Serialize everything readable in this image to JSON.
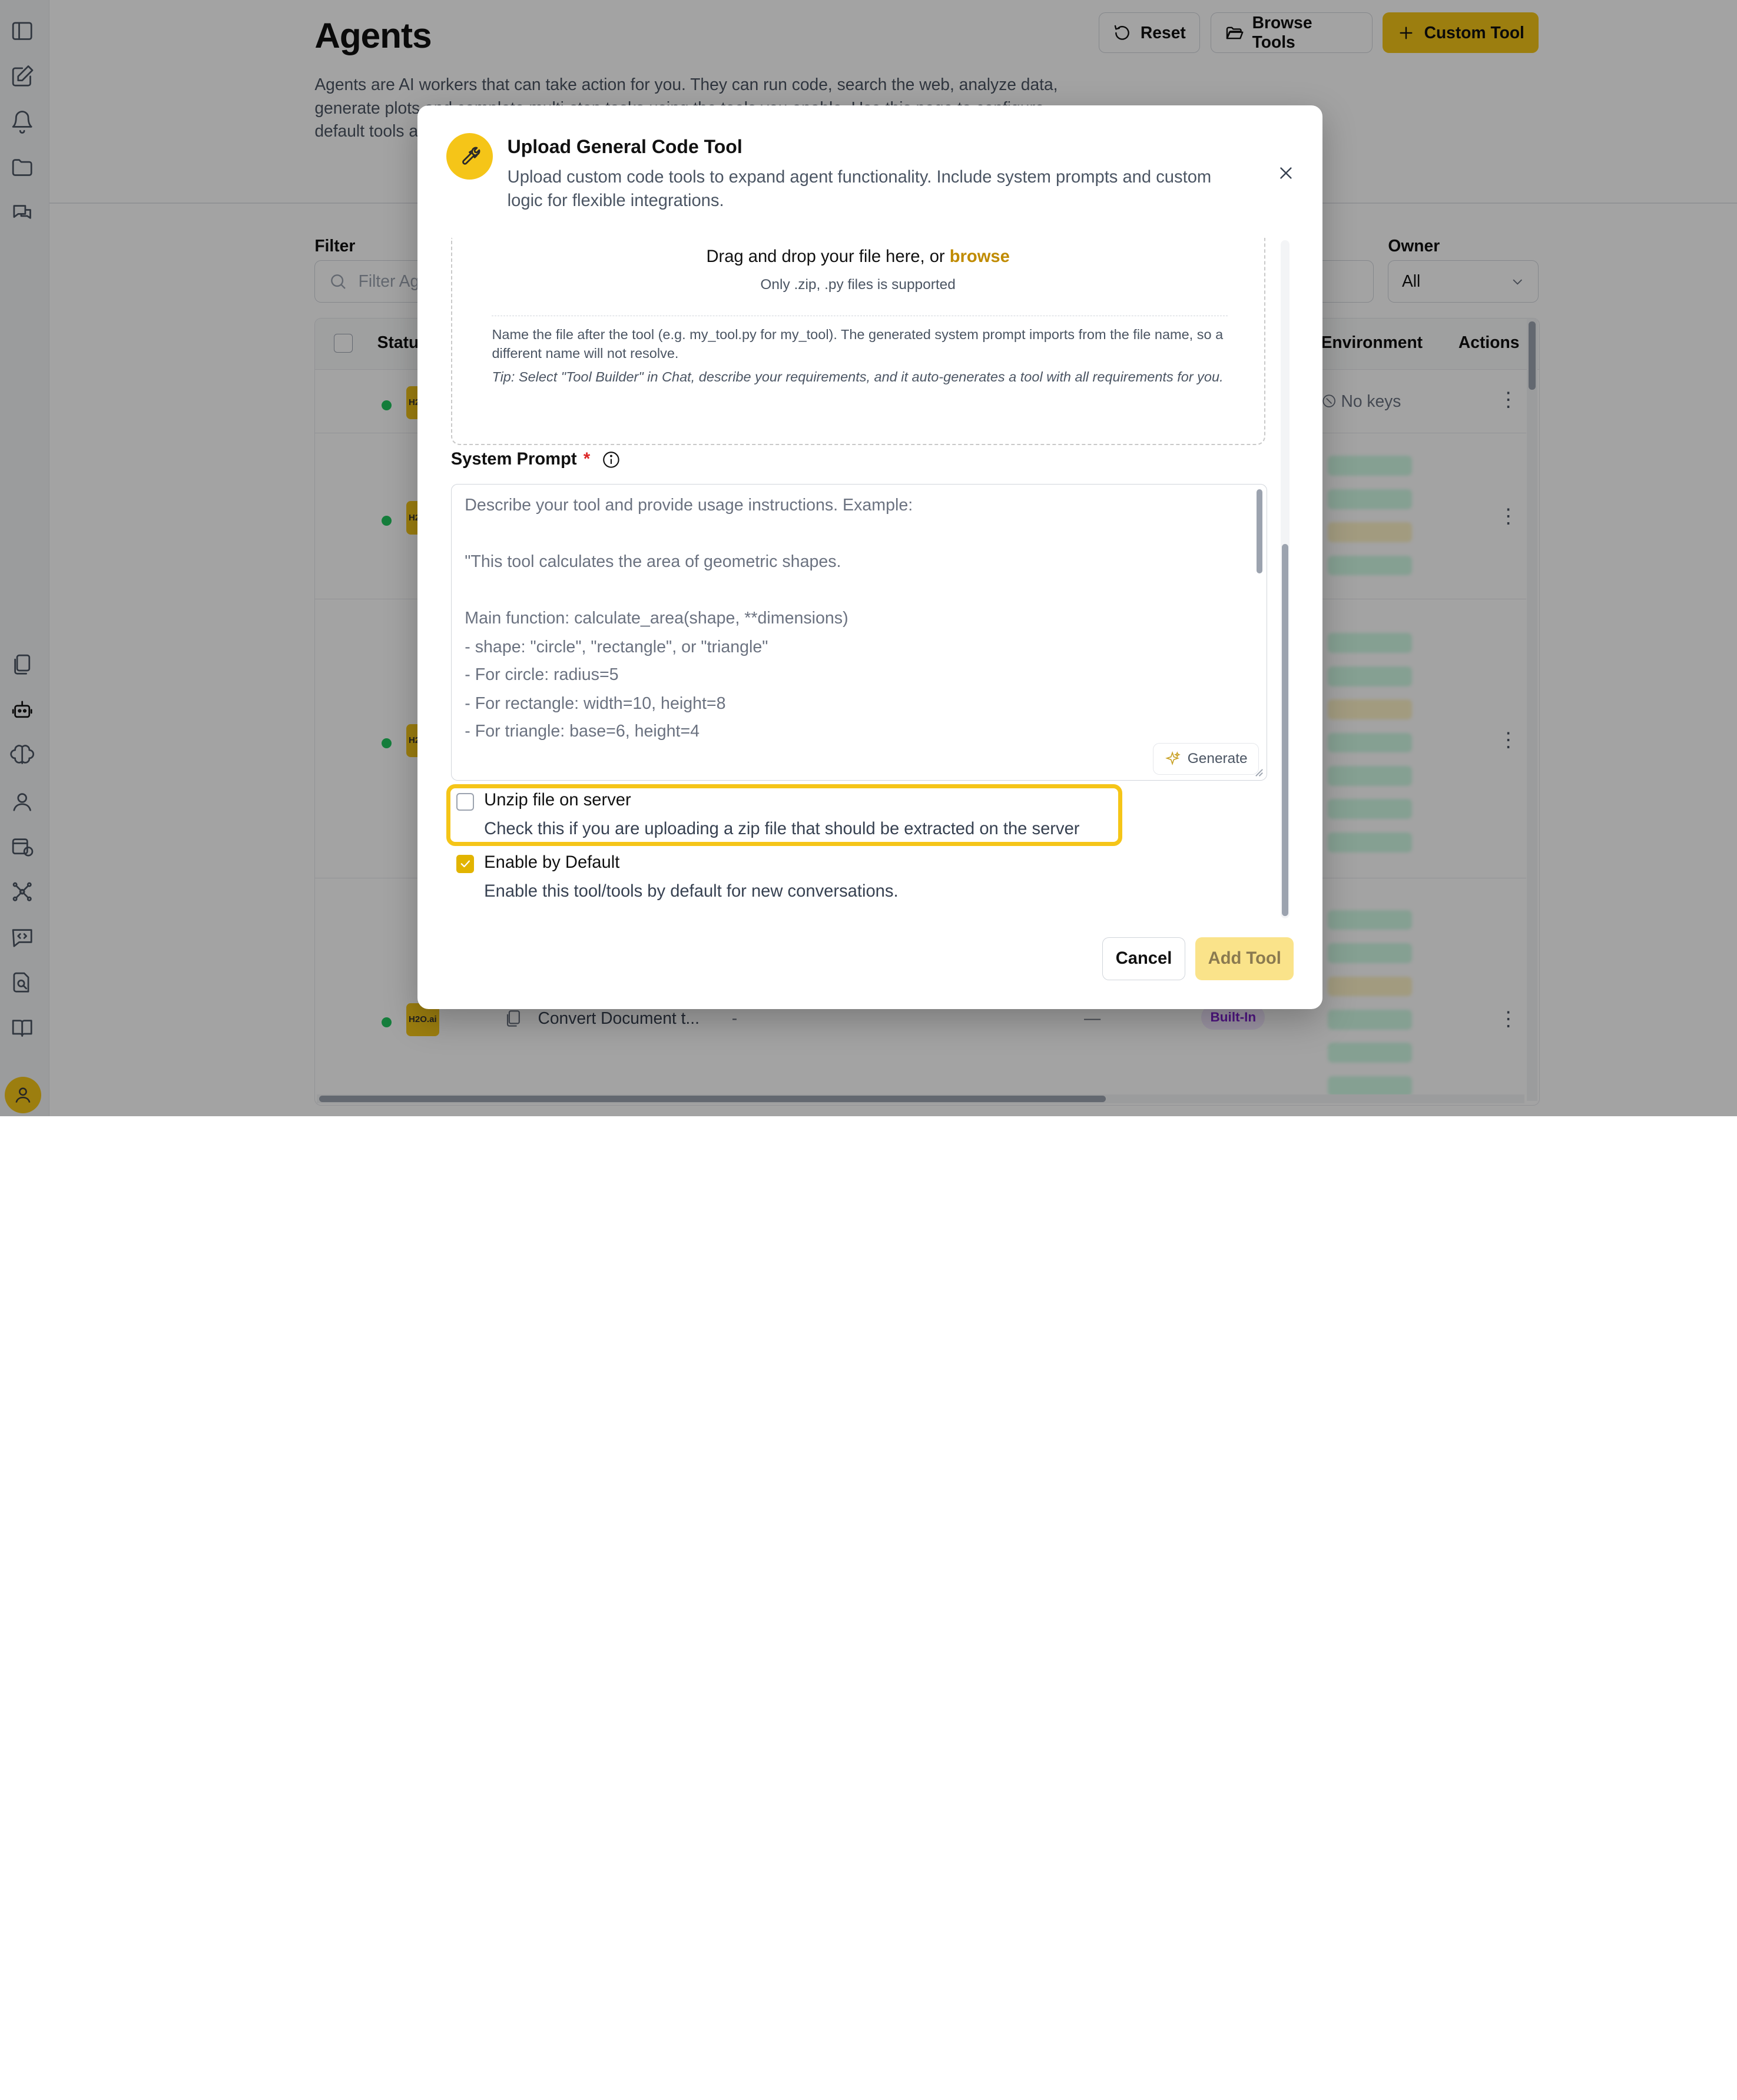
{
  "page": {
    "title": "Agents",
    "description": "Agents are AI workers that can take action for you. They can run code, search the web, analyze data, generate plots and complete multi-step tasks using the tools you enable. Use this page to configure default tools and settings for your agents."
  },
  "header": {
    "reset_label": "Reset",
    "browse_label": "Browse Tools",
    "custom_label": "Custom Tool"
  },
  "filters": {
    "filter_label": "Filter",
    "filter_placeholder": "Filter Agents",
    "owner_label": "Owner",
    "owner_value": "All"
  },
  "table": {
    "columns": {
      "status": "Status",
      "environment": "Environment",
      "actions": "Actions"
    },
    "no_keys": "No keys",
    "logo_text": "H2O.ai",
    "last_row": {
      "name": "Convert Document t...",
      "dash1": "-",
      "dash2": "—",
      "badge": "Built-In"
    }
  },
  "modal": {
    "title": "Upload General Code Tool",
    "subtitle": "Upload custom code tools to expand agent functionality. Include system prompts and custom logic for flexible integrations.",
    "dropzone": {
      "text": "Drag and drop your file here, or",
      "browse": "browse",
      "only": "Only .zip, .py files is supported",
      "note": "Name the file after the tool (e.g. my_tool.py for my_tool). The generated system prompt imports from the file name, so a different name will not resolve.",
      "tip": "Tip: Select \"Tool Builder\" in Chat, describe your requirements, and it auto-generates a tool with all requirements for you."
    },
    "system_prompt": {
      "label": "System Prompt",
      "required_mark": "*",
      "placeholder_lines": [
        "Describe your tool and provide usage instructions. Example:",
        "",
        "\"This tool calculates the area of geometric shapes.",
        "",
        "Main function: calculate_area(shape, **dimensions)",
        "- shape: \"circle\", \"rectangle\", or \"triangle\"",
        "- For circle: radius=5",
        "- For rectangle: width=10, height=8",
        "- For triangle: base=6, height=4"
      ],
      "generate_label": "Generate"
    },
    "unzip": {
      "label": "Unzip file on server",
      "description": "Check this if you are uploading a zip file that should be extracted on the server",
      "checked": false
    },
    "enable_default": {
      "label": "Enable by Default",
      "description": "Enable this tool/tools by default for new conversations.",
      "checked": true
    },
    "cancel_label": "Cancel",
    "add_label": "Add Tool"
  },
  "colors": {
    "accent": "#f5c518",
    "highlight": "#f5c518",
    "browse_link": "#c08b00",
    "required": "#dc2626",
    "status_active": "#22c55e",
    "builtin_badge": "#7e22ce"
  },
  "icons": {
    "sidebar_top": [
      "sidebar-toggle-icon",
      "new-chat-icon",
      "bell-icon",
      "folder-icon",
      "chat-bubbles-icon"
    ],
    "sidebar_bottom": [
      "documents-icon",
      "robot-icon",
      "brain-icon",
      "person-icon",
      "calendar-clock-icon",
      "network-icon",
      "code-chat-icon",
      "doc-search-icon",
      "book-icon"
    ]
  }
}
